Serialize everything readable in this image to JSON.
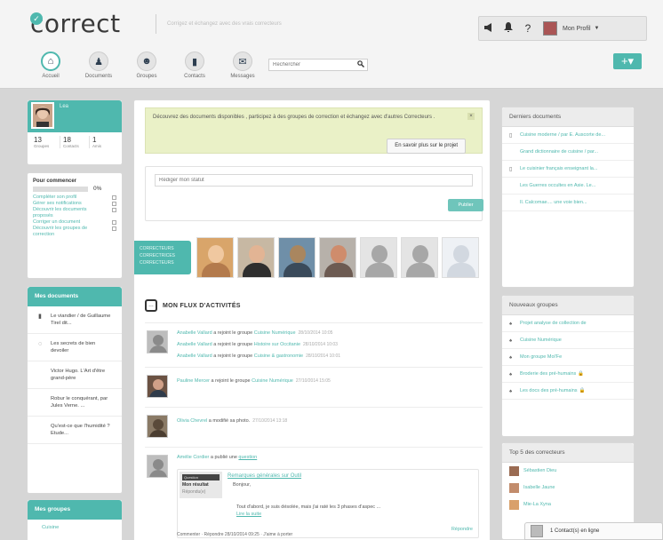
{
  "header": {
    "logo": "correct",
    "logo_badge": "✓",
    "tagline": "Corrigez et échangez avec des vrais correcteurs",
    "top_icons": [
      "megaphone-icon",
      "bell-icon",
      "help-icon"
    ],
    "help_glyph": "?",
    "profile_label": "Mon Profil",
    "profile_caret": "▼",
    "nav": [
      {
        "label": "Accueil",
        "icon": "home-icon",
        "glyph": "⌂"
      },
      {
        "label": "Documents",
        "icon": "binoculars-icon",
        "glyph": "♟"
      },
      {
        "label": "Groupes",
        "icon": "groups-icon",
        "glyph": "☻"
      },
      {
        "label": "Contacts",
        "icon": "contacts-book-icon",
        "glyph": "▮"
      },
      {
        "label": "Messages",
        "icon": "messages-icon",
        "glyph": "✉"
      }
    ],
    "search_placeholder": "Rechercher",
    "add_label": "+▾"
  },
  "profile": {
    "name": "Lea",
    "stats": [
      {
        "num": "13",
        "label": "Groupes"
      },
      {
        "num": "18",
        "label": "Contacts"
      },
      {
        "num": "1",
        "label": "Amis"
      }
    ]
  },
  "start": {
    "title": "Pour commencer",
    "progress_value": 0,
    "progress_text": "0%",
    "tasks": [
      "Compléter son profil",
      "Gérer ses notifications",
      "Découvrir les documents proposés",
      "Corriger un document",
      "Découvrir les groupes de correction"
    ]
  },
  "mydocs": {
    "title": "Mes documents",
    "items": [
      "Le viandier / de Guillaume Tirel dit...",
      "Les secrets de bien devoiler",
      "Victor Hugo. L'Art d'être grand-père",
      "Robur le conquérant, par Jules Verne. ...",
      "Qu'est-ce que l'humidité ? Etude..."
    ]
  },
  "mygroups": {
    "title": "Mes groupes",
    "first_item": "Cuisine"
  },
  "welcome": {
    "text": "Découvrez des documents disponibles , participez à des groupes de correction et échangez avec d'autres Correcteurs .",
    "close": "×",
    "button": "En savoir plus sur le projet"
  },
  "status": {
    "placeholder": "Rédiger mon statut",
    "publish": "Publier"
  },
  "correctors_tag": [
    "CORRECTEURS",
    "CORRECTRICES",
    "CORRECTEURS"
  ],
  "feed": {
    "title": "MON FLUX D'ACTIVITÉS",
    "joined": [
      {
        "user": "Anabelle Vallard",
        "verb": "a rejoint le groupe",
        "group": "Cuisine Numérique",
        "date": "28/10/2014 10:05"
      },
      {
        "user": "Anabelle Vallard",
        "verb": "a rejoint le groupe",
        "group": "Histoire sur Occitanie",
        "date": "28/10/2014 10:03"
      },
      {
        "user": "Anabelle Vallard",
        "verb": "a rejoint le groupe",
        "group": "Cuisine & gastronomie",
        "date": "28/10/2014 10:01"
      }
    ],
    "entry2": {
      "user": "Pauline Mercer",
      "verb": "a rejoint le groupe",
      "group": "Cuisine Numérique",
      "date": "27/10/2014 15:05"
    },
    "entry3": {
      "user": "Olivia Chevrel",
      "verb": "a modifié sa photo.",
      "date": "27/10/2014 13:18"
    },
    "entry4": {
      "user": "Amélie Cordier",
      "verb": "a publié une",
      "object": "question",
      "quote_tag": "Question",
      "quote_author": "Mon résultat",
      "quote_sub": "Répondu(e)",
      "quote_title": "Remarques générales sur Outil",
      "hello": "Bonjour,",
      "body": "Tout d'abord, je suis désolée, mais j'ai raté les 3 phases d'aspec ...",
      "link": "Lire la suite",
      "reply": "Répondre"
    },
    "footer": "Commenter  ·  Répondre 28/10/2014 09:25  ·  J'aime à porter"
  },
  "last_docs": {
    "title": "Derniers documents",
    "items": [
      "Cuisine moderne / par E. Auscorte de...",
      "Grand dictionnaire de cuisine / par...",
      "Le cuisinier français enseignant la...",
      "Les Guerres occultes en Asie. Le...",
      "Il. Calcomae.... une voie bien..."
    ]
  },
  "new_groups": {
    "title": "Nouveaux groupes",
    "items": [
      {
        "label": "Projet analyse de collection de",
        "locked": false
      },
      {
        "label": "Cuisine Numérique",
        "locked": false
      },
      {
        "label": "Mon groupe Mol'Fe",
        "locked": false
      },
      {
        "label": "Broderie des pré-humains",
        "locked": true
      },
      {
        "label": "Les docs des pré-humains",
        "locked": true
      }
    ],
    "lock_glyph": "🔒"
  },
  "top5": {
    "title": "Top 5 des correcteurs",
    "items": [
      "Sébastien Dieu",
      "Isabelle Jaune",
      "Mie-La Xyna"
    ]
  },
  "contacts_bar": "1 Contact(s) en ligne",
  "colors": {
    "accent": "#4fb8ae",
    "welcome_bg": "#eaf1c7"
  }
}
